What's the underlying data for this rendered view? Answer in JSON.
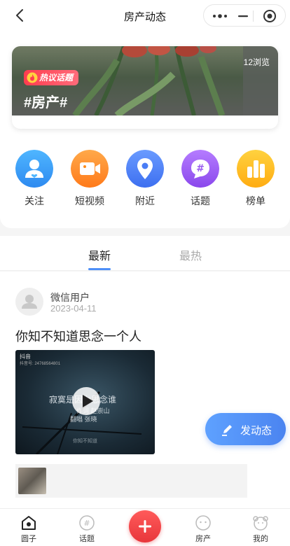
{
  "nav": {
    "title": "房产动态"
  },
  "banner": {
    "views": "12浏览",
    "tag": "热议话题",
    "topic": "#房产#"
  },
  "categories": [
    {
      "label": "关注",
      "icon": "follow-icon",
      "color": "#2e9af5"
    },
    {
      "label": "短视频",
      "icon": "video-camera-icon",
      "color": "#ff8c1a"
    },
    {
      "label": "附近",
      "icon": "location-pin-icon",
      "color": "#4a7df5"
    },
    {
      "label": "话题",
      "icon": "hashtag-icon",
      "color": "#9a5cf0"
    },
    {
      "label": "榜单",
      "icon": "ranking-icon",
      "color": "#ffbf1a"
    }
  ],
  "tabs": {
    "new": "最新",
    "hot": "最热"
  },
  "post": {
    "user": "微信用户",
    "date": "2023-04-11",
    "text": "你知不知道思念一个人",
    "video": {
      "logo": "抖音",
      "id": "抖音号: 24768564801",
      "lyric1": "寂寞是因为思念谁",
      "lyric2": "作词 赵崇山",
      "lyric3": "翻唱 张晓",
      "lyric4": "你知不知道"
    }
  },
  "post_button": "发动态",
  "tabbar": {
    "circle": "圆子",
    "topic": "话题",
    "house": "房产",
    "mine": "我的"
  },
  "colors": {
    "accent": "#4b84f0",
    "center_button": "#e8363b"
  }
}
